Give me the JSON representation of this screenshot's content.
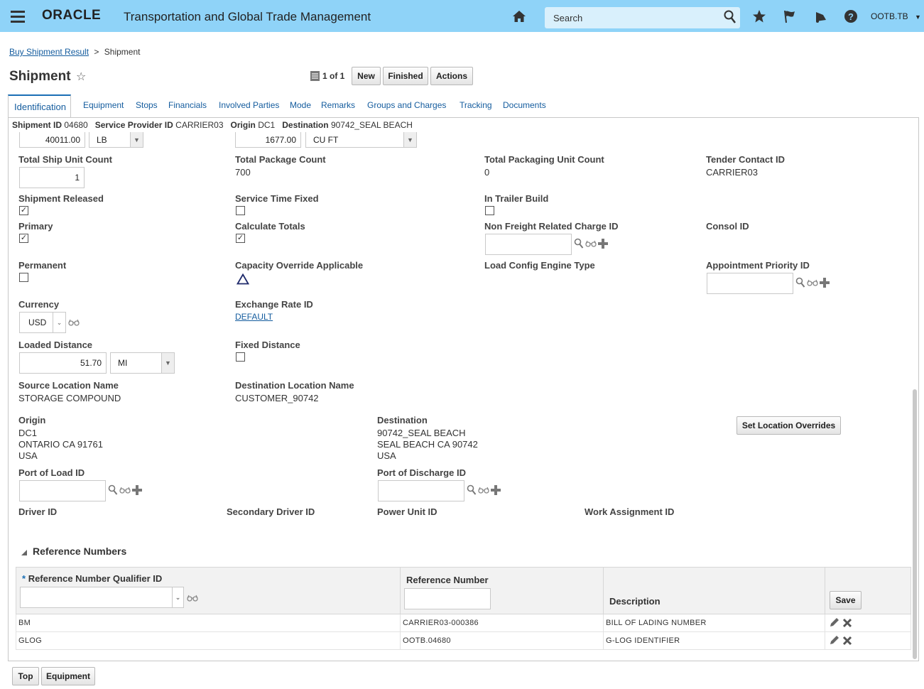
{
  "header": {
    "logo": "ORACLE",
    "app_title": "Transportation and Global Trade Management",
    "search_placeholder": "Search",
    "user": "OOTB.TB"
  },
  "breadcrumb": {
    "parent": "Buy Shipment Result",
    "separator": ">",
    "current": "Shipment"
  },
  "page": {
    "title": "Shipment",
    "pager": "1 of 1"
  },
  "buttons": {
    "new": "New",
    "finished": "Finished",
    "actions": "Actions",
    "set_location_overrides": "Set Location Overrides",
    "save": "Save",
    "top": "Top",
    "equipment": "Equipment"
  },
  "tabs": [
    "Identification",
    "Equipment",
    "Stops",
    "Financials",
    "Involved Parties",
    "Mode",
    "Remarks",
    "Groups and Charges",
    "Tracking",
    "Documents"
  ],
  "summary": {
    "shipment_id_label": "Shipment ID",
    "shipment_id": "04680",
    "sp_label": "Service Provider ID",
    "sp": "CARRIER03",
    "origin_label": "Origin",
    "origin": "DC1",
    "dest_label": "Destination",
    "dest": "90742_SEAL BEACH"
  },
  "top_fields": {
    "weight": "40011.00",
    "weight_uom": "LB",
    "volume": "1677.00",
    "volume_uom": "CU FT"
  },
  "fields": {
    "total_ship_unit_count_label": "Total Ship Unit Count",
    "total_ship_unit_count": "1",
    "total_package_count_label": "Total Package Count",
    "total_package_count": "700",
    "total_packaging_unit_count_label": "Total Packaging Unit Count",
    "total_packaging_unit_count": "0",
    "tender_contact_id_label": "Tender Contact ID",
    "tender_contact_id": "CARRIER03",
    "shipment_released_label": "Shipment Released",
    "service_time_fixed_label": "Service Time Fixed",
    "in_trailer_build_label": "In Trailer Build",
    "primary_label": "Primary",
    "calculate_totals_label": "Calculate Totals",
    "non_freight_label": "Non Freight Related Charge ID",
    "consol_id_label": "Consol ID",
    "permanent_label": "Permanent",
    "capacity_override_label": "Capacity Override Applicable",
    "load_config_label": "Load Config Engine Type",
    "appointment_priority_label": "Appointment Priority ID",
    "currency_label": "Currency",
    "currency": "USD",
    "exchange_rate_label": "Exchange Rate ID",
    "exchange_rate": "DEFAULT",
    "loaded_distance_label": "Loaded Distance",
    "loaded_distance": "51.70",
    "distance_uom": "MI",
    "fixed_distance_label": "Fixed Distance",
    "source_location_name_label": "Source Location Name",
    "source_location_name": "STORAGE COMPOUND",
    "destination_location_name_label": "Destination Location Name",
    "destination_location_name": "CUSTOMER_90742",
    "origin_label": "Origin",
    "origin_line1": "DC1",
    "origin_line2": "ONTARIO CA 91761",
    "origin_line3": "USA",
    "destination_label": "Destination",
    "destination_line1": "90742_SEAL BEACH",
    "destination_line2": "SEAL BEACH CA 90742",
    "destination_line3": "USA",
    "port_of_load_label": "Port of Load ID",
    "port_of_discharge_label": "Port of Discharge ID",
    "driver_id_label": "Driver ID",
    "secondary_driver_label": "Secondary Driver ID",
    "power_unit_label": "Power Unit ID",
    "work_assignment_label": "Work Assignment ID"
  },
  "checkboxes": {
    "shipment_released": true,
    "service_time_fixed": false,
    "in_trailer_build": false,
    "primary": true,
    "calculate_totals": true,
    "permanent": false,
    "fixed_distance": false
  },
  "reference_numbers": {
    "section_title": "Reference Numbers",
    "required_mark": "*",
    "columns": [
      "Reference Number Qualifier ID",
      "Reference Number",
      "Description"
    ],
    "rows": [
      {
        "qualifier": "BM",
        "number": "CARRIER03-000386",
        "description": "BILL OF LADING NUMBER"
      },
      {
        "qualifier": "GLOG",
        "number": "OOTB.04680",
        "description": "G-LOG IDENTIFIER"
      }
    ]
  },
  "colors": {
    "topbar": "#8fd3f8",
    "link": "#145c9e",
    "tab_active_border": "#1a6fb5"
  }
}
